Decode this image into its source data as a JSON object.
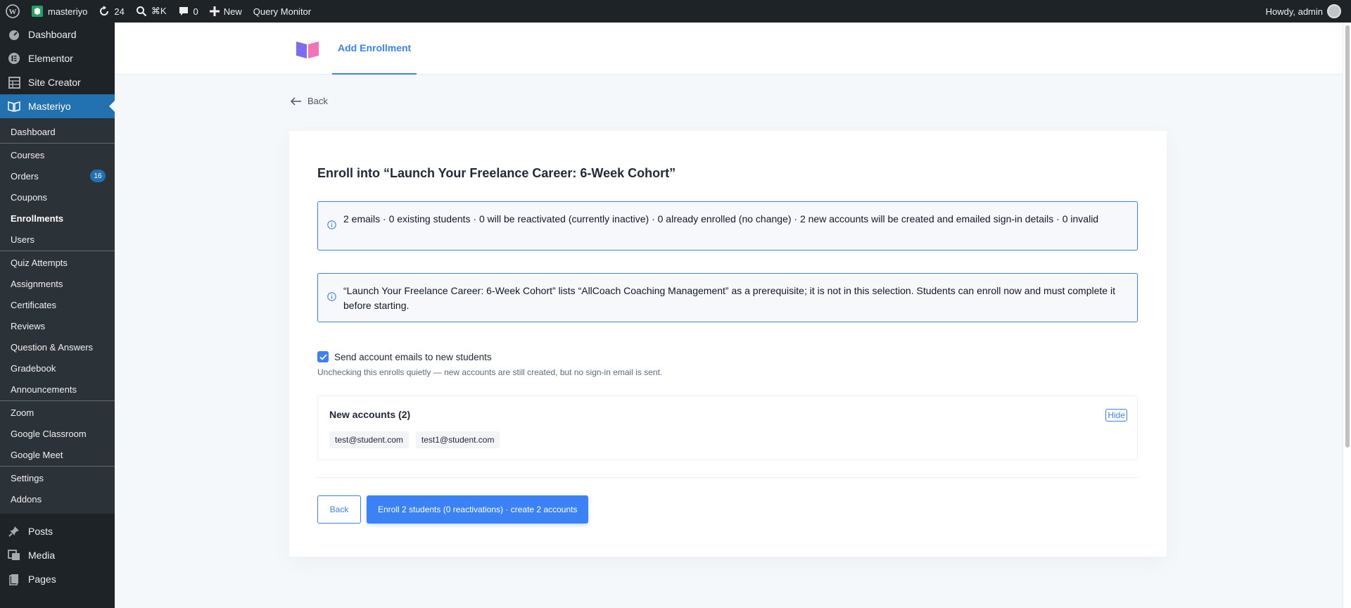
{
  "admin_bar": {
    "site_name": "masteriyo",
    "updates_count": "24",
    "search_shortcut": "⌘K",
    "comments_count": "0",
    "new_label": "New",
    "query_monitor": "Query Monitor",
    "howdy": "Howdy, admin"
  },
  "sidebar": {
    "top_items": [
      {
        "label": "Dashboard",
        "icon": "dashboard-icon"
      },
      {
        "label": "Elementor",
        "icon": "elementor-icon"
      },
      {
        "label": "Site Creator",
        "icon": "table-icon"
      },
      {
        "label": "Masteriyo",
        "icon": "book-icon"
      }
    ],
    "submenu": [
      "Dashboard",
      "Courses",
      "Orders",
      "Coupons",
      "Enrollments",
      "Users",
      "Quiz Attempts",
      "Assignments",
      "Certificates",
      "Reviews",
      "Question & Answers",
      "Gradebook",
      "Announcements",
      "Zoom",
      "Google Classroom",
      "Google Meet",
      "Settings",
      "Addons"
    ],
    "orders_badge": "16",
    "bottom_items": [
      {
        "label": "Posts",
        "icon": "pin-icon"
      },
      {
        "label": "Media",
        "icon": "media-icon"
      },
      {
        "label": "Pages",
        "icon": "page-icon"
      }
    ]
  },
  "header": {
    "tab_label": "Add Enrollment"
  },
  "back_link": "Back",
  "card": {
    "title": "Enroll into “Launch Your Freelance Career: 6-Week Cohort”",
    "notice_summary": "2 emails · 0 existing students · 0 will be reactivated (currently inactive) · 0 already enrolled (no change) · 2 new accounts will be created and emailed sign-in details · 0 invalid",
    "notice_prereq": "“Launch Your Freelance Career: 6-Week Cohort” lists “AllCoach Coaching Management” as a prerequisite; it is not in this selection. Students can enroll now and must complete it before starting.",
    "send_emails_label": "Send account emails to new students",
    "send_emails_checked": true,
    "send_emails_hint": "Unchecking this enrolls quietly — new accounts are still created, but no sign-in email is sent.",
    "new_accounts_title": "New accounts (2)",
    "hide_label": "Hide",
    "new_accounts": [
      "test@student.com",
      "test1@student.com"
    ],
    "back_button": "Back",
    "submit_button": "Enroll 2 students (0 reactivations) · create 2 accounts"
  },
  "colors": {
    "accent": "#3b82f6",
    "wp_admin_bg": "#1d2327",
    "wp_active": "#2271b1"
  }
}
